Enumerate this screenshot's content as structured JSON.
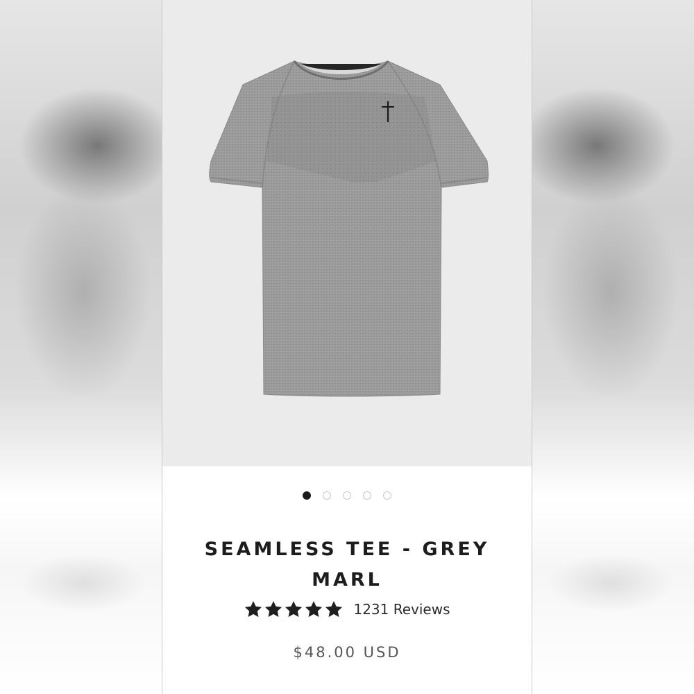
{
  "product": {
    "title": "SEAMLESS TEE - GREY MARL",
    "rating_value": 5,
    "review_count_label": "1231 Reviews",
    "price": "$48.00 USD",
    "image_icon": "grey-tshirt-image",
    "logo_icon": "cross-logo-icon"
  },
  "carousel": {
    "total_slides": 5,
    "active_index": 0
  },
  "colors": {
    "shirt": "#9a9a9a",
    "image_bg": "#ebebeb",
    "active_dot": "#1a1a1a",
    "text": "#1d1d1d"
  }
}
